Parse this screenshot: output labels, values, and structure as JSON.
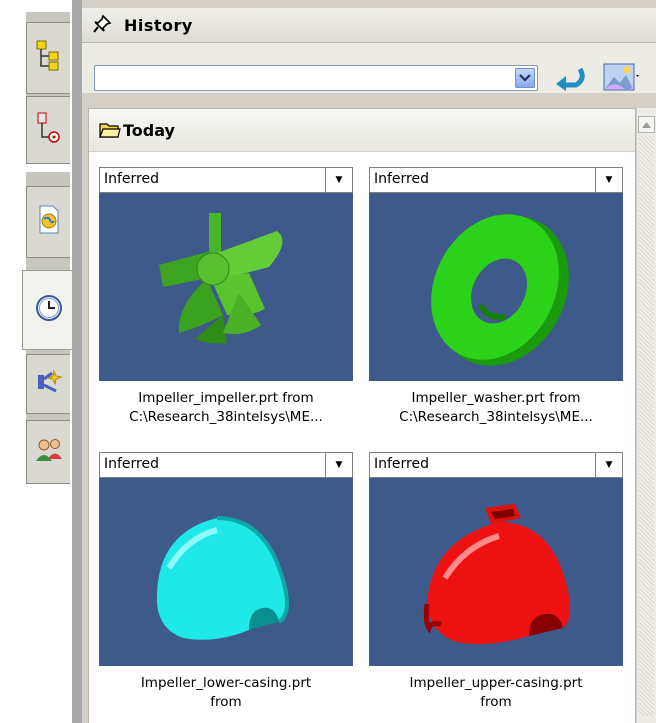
{
  "sidebar": {
    "tabs": [
      {
        "icon": "assembly-navigator-icon"
      },
      {
        "icon": "constraint-navigator-icon"
      },
      {
        "icon": "web-browser-icon"
      },
      {
        "icon": "history-clock-icon",
        "active": true
      },
      {
        "icon": "process-studio-icon"
      },
      {
        "icon": "roles-icon"
      }
    ]
  },
  "panel": {
    "title": "History",
    "pin_icon": "pushpin-icon",
    "toolbar": {
      "search_value": "",
      "dropdown_icon": "chevron-down-icon",
      "back_icon": "back-arrow-icon",
      "view_icon": "image-view-icon"
    },
    "group": {
      "title": "Today",
      "icon": "folder-icon"
    },
    "items": [
      {
        "mode": "Inferred",
        "caption_line1": "Impeller_impeller.prt from",
        "caption_line2": "C:\\Research_38intelsys\\ME...",
        "color": "#3fbf1f"
      },
      {
        "mode": "Inferred",
        "caption_line1": "Impeller_washer.prt from",
        "caption_line2": "C:\\Research_38intelsys\\ME...",
        "color": "#22cc11"
      },
      {
        "mode": "Inferred",
        "caption_line1": "Impeller_lower-casing.prt",
        "caption_line2": "from",
        "color": "#19e6e6"
      },
      {
        "mode": "Inferred",
        "caption_line1": "Impeller_upper-casing.prt",
        "caption_line2": "from",
        "color": "#ee1111"
      }
    ]
  },
  "colors": {
    "thumb_bg": "#3d5a8a",
    "panel_bg": "#d4d0c8"
  }
}
